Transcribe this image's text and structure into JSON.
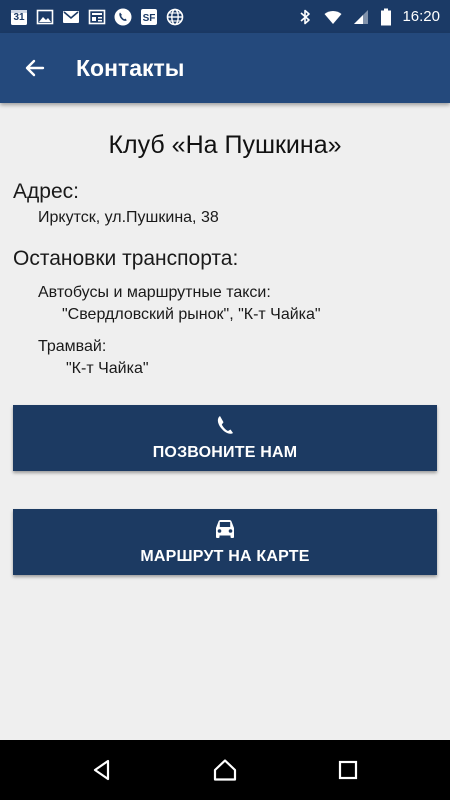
{
  "status_bar": {
    "calendar_day": "31",
    "time": "16:20",
    "left_icons": [
      "calendar-icon",
      "image-icon",
      "mail-icon",
      "news-icon",
      "phone-icon",
      "sf-icon",
      "globe-icon"
    ],
    "right_icons": [
      "bluetooth-icon",
      "wifi-icon",
      "signal-icon",
      "battery-icon"
    ]
  },
  "app_bar": {
    "title": "Контакты",
    "back_icon": "arrow-left-icon"
  },
  "main": {
    "club_title": "Клуб «На Пушкина»",
    "address_label": "Адрес:",
    "address_value": "Иркутск, ул.Пушкина, 38",
    "transport_label": "Остановки транспорта:",
    "bus_label": "Автобусы и маршрутные такси:",
    "bus_stops": "\"Свердловский рынок\", \"К-т Чайка\"",
    "tram_label": "Трамвай:",
    "tram_stops": "\"К-т Чайка\""
  },
  "buttons": {
    "call_label": "ПОЗВОНИТЕ НАМ",
    "call_icon": "phone-handset-icon",
    "route_label": "МАРШРУТ НА КАРТЕ",
    "route_icon": "car-icon"
  },
  "colors": {
    "status_bar": "#1b3a66",
    "app_bar": "#24497c",
    "button": "#1c3a62",
    "background": "#efefef"
  },
  "nav_bar": {
    "icons": [
      "back-triangle-icon",
      "home-icon",
      "recents-icon"
    ]
  }
}
